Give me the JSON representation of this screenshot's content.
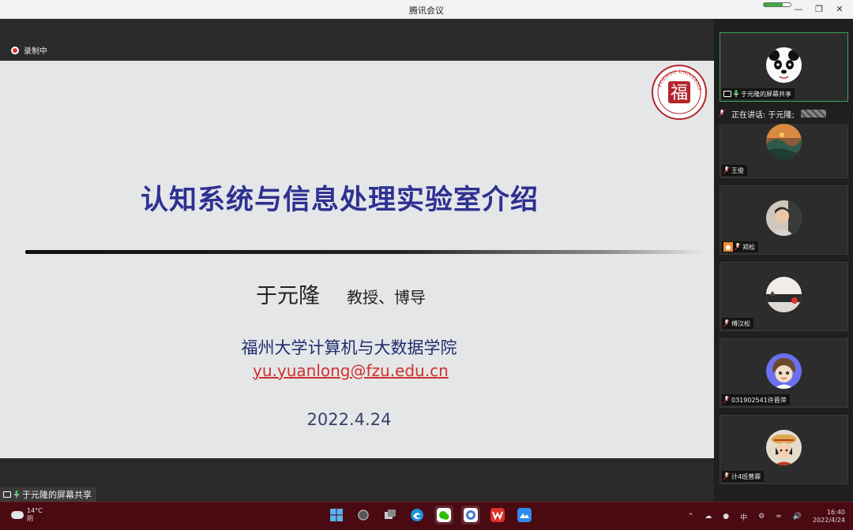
{
  "window": {
    "title": "腾讯会议"
  },
  "recording": {
    "label": "录制中"
  },
  "slide": {
    "title": "认知系统与信息处理实验室介绍",
    "presenter": "于元隆",
    "presenter_title": "教授、博导",
    "school": "福州大学计算机与大数据学院",
    "email": "yu.yuanlong@fzu.edu.cn",
    "date": "2022.4.24",
    "logo_text": "福"
  },
  "share_label": "于元隆的屏幕共享",
  "speaking": {
    "label": "正在讲话: 于元隆;"
  },
  "participants": [
    {
      "name": "于元隆的屏幕共享",
      "avatar": "panda-avatar",
      "sharing": true
    },
    {
      "name": "王俊",
      "avatar": "landscape-avatar"
    },
    {
      "name": "郑松",
      "avatar": "person-avatar",
      "has_video_off_icon": true
    },
    {
      "name": "傅汉松",
      "avatar": "sunset-avatar"
    },
    {
      "name": "031902541许晋萍",
      "avatar": "cartoon-avatar"
    },
    {
      "name": "计4班曾霖",
      "avatar": "anime-avatar"
    }
  ],
  "taskbar": {
    "weather_temp": "14°C",
    "weather_desc": "阴",
    "tray_input": "中",
    "clock_time": "16:40",
    "clock_date": "2022/4/24"
  },
  "colors": {
    "slide_title": "#2e3192",
    "email": "#d0312d",
    "taskbar": "#4a0a12",
    "active_tile": "#3aa757"
  }
}
